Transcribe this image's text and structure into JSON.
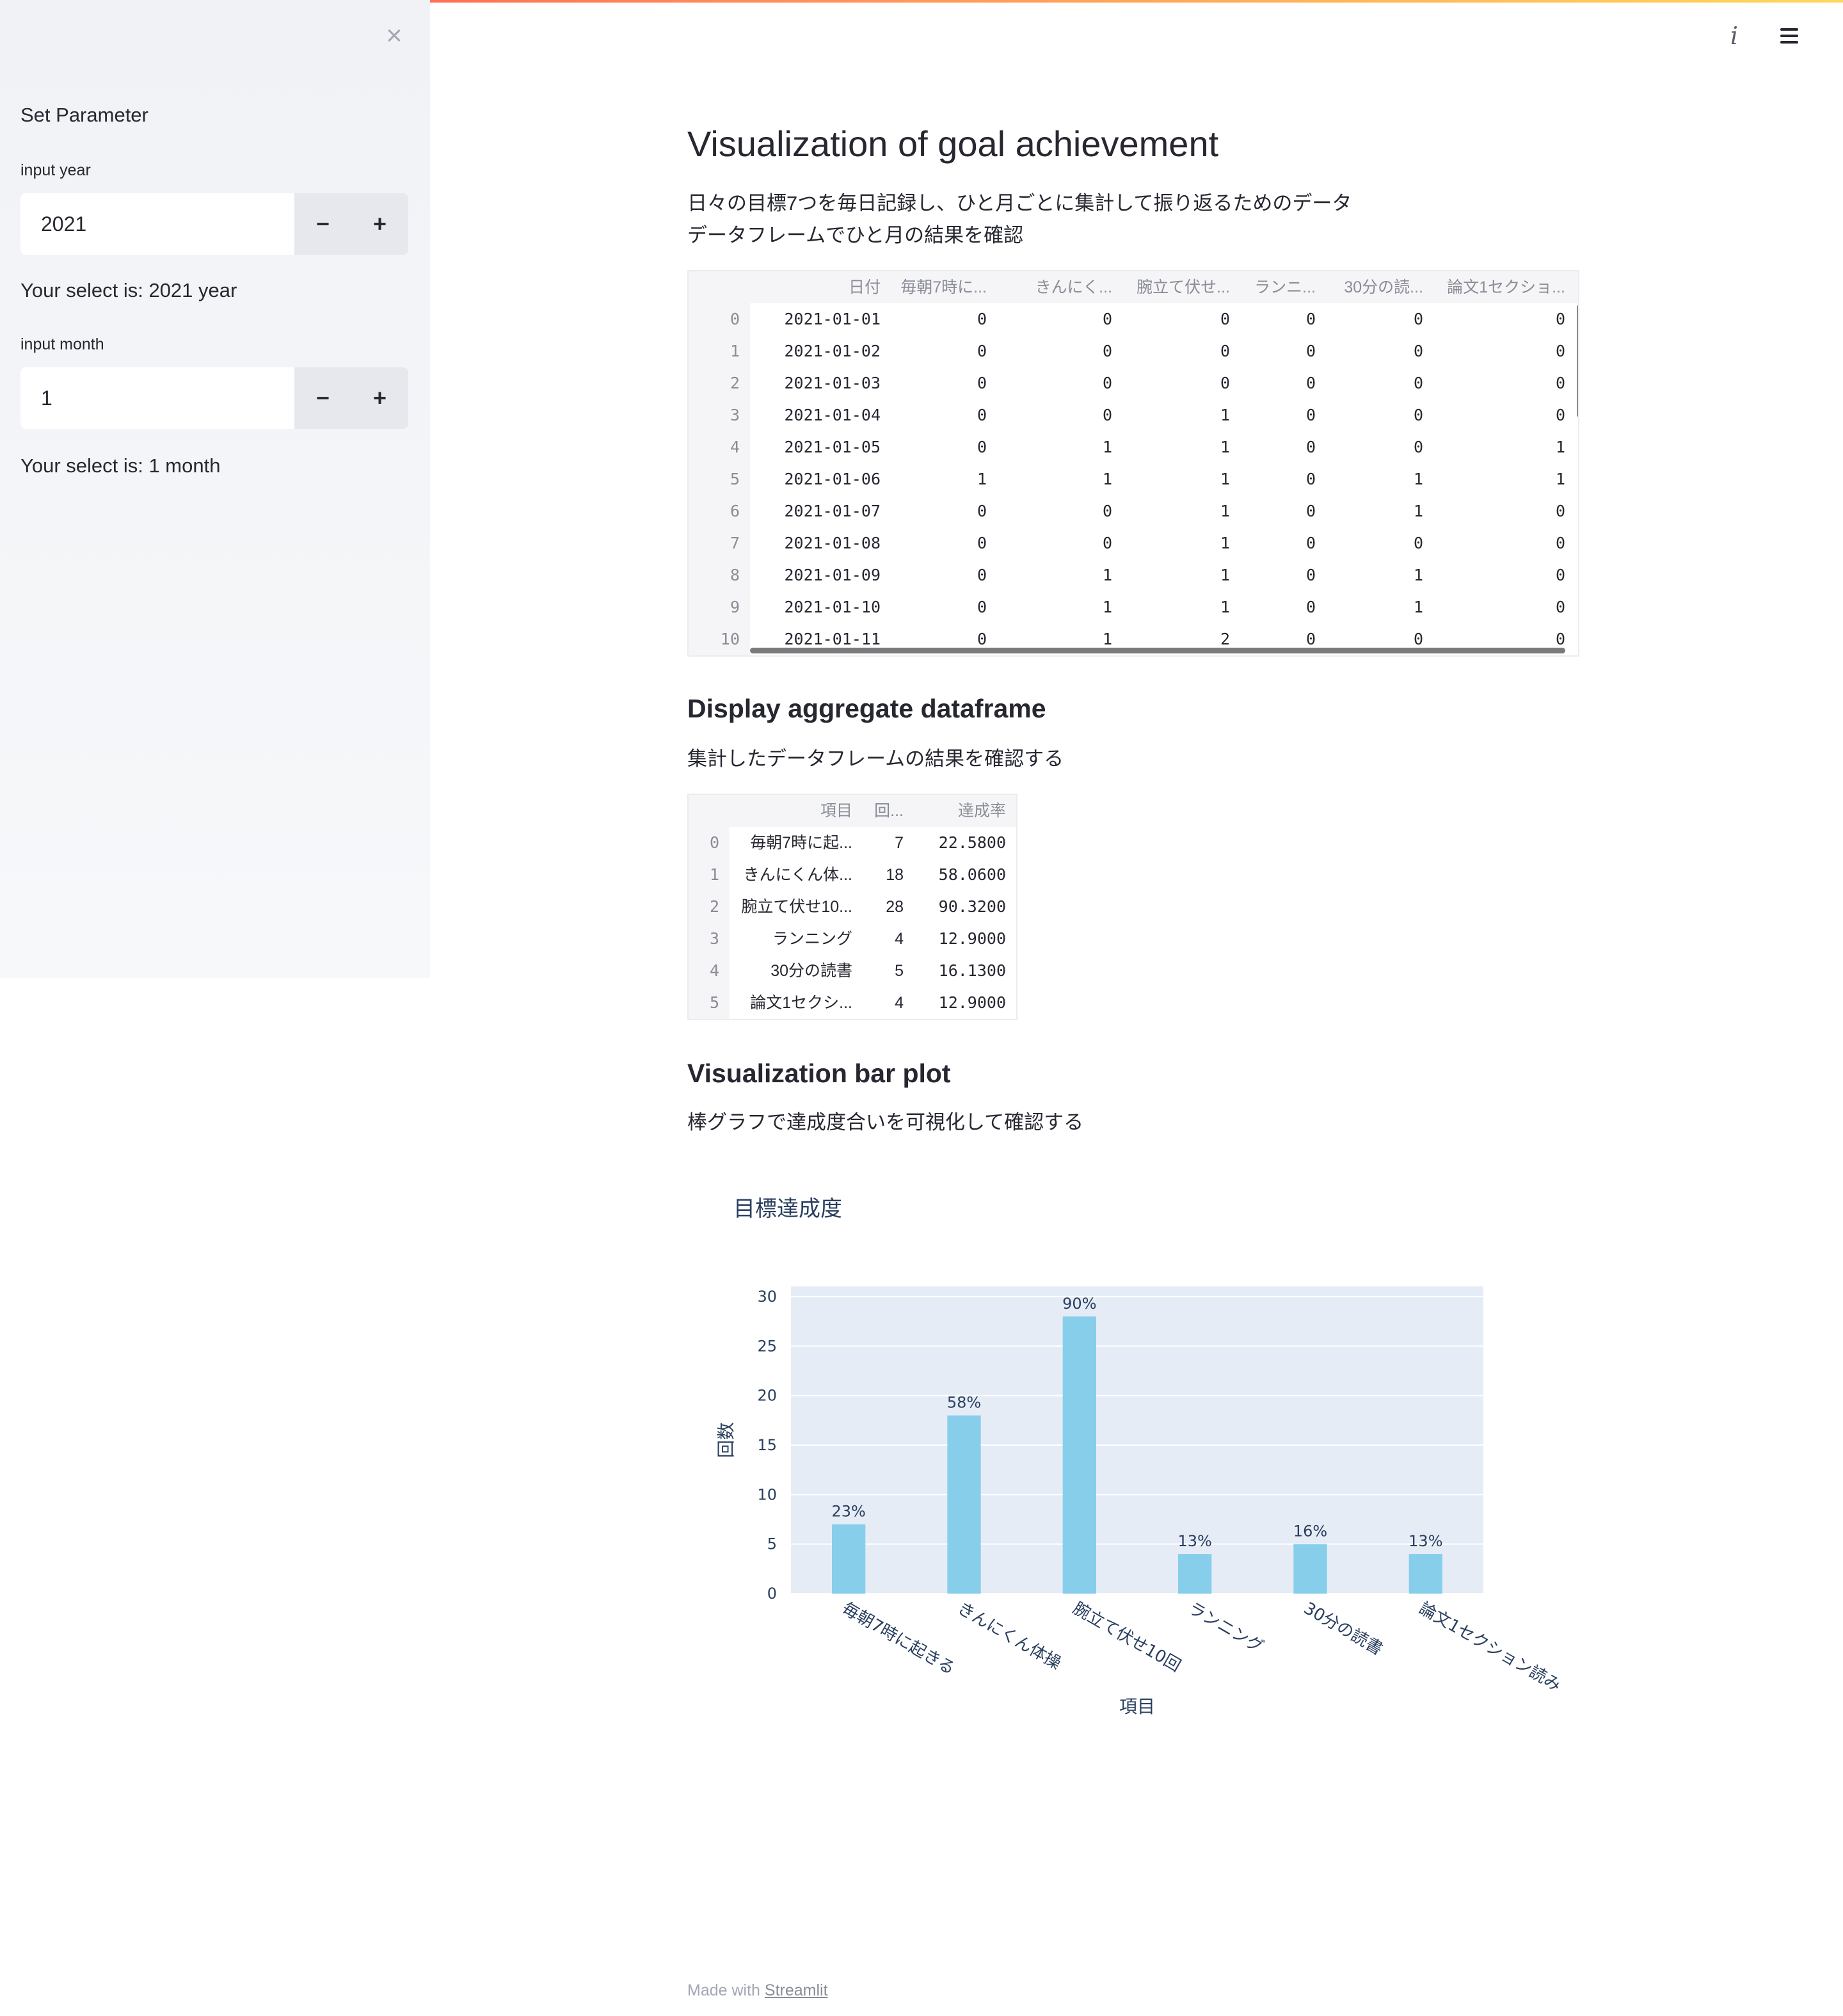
{
  "sidebar": {
    "close_icon": "close-icon",
    "header": "Set Parameter",
    "year": {
      "label": "input year",
      "value": "2021",
      "minus": "−",
      "plus": "+",
      "status": "Your select is: 2021 year"
    },
    "month": {
      "label": "input month",
      "value": "1",
      "minus": "−",
      "plus": "+",
      "status": "Your select is: 1 month"
    }
  },
  "header": {
    "info_glyph": "i",
    "info_icon": "info-icon",
    "menu_icon": "hamburger-menu-icon"
  },
  "main": {
    "title": "Visualization of goal achievement",
    "desc1": "日々の目標7つを毎日記録し、ひと月ごとに集計して振り返るためのデータ",
    "desc2": "データフレームでひと月の結果を確認",
    "df1": {
      "columns": [
        "日付",
        "毎朝7時に...",
        "きんにく...",
        "腕立て伏せ...",
        "ランニ...",
        "30分の読...",
        "論文1セクショ..."
      ],
      "rows": [
        {
          "idx": "0",
          "date": "2021-01-01",
          "v": [
            "0",
            "0",
            "0",
            "0",
            "0",
            "0"
          ]
        },
        {
          "idx": "1",
          "date": "2021-01-02",
          "v": [
            "0",
            "0",
            "0",
            "0",
            "0",
            "0"
          ]
        },
        {
          "idx": "2",
          "date": "2021-01-03",
          "v": [
            "0",
            "0",
            "0",
            "0",
            "0",
            "0"
          ]
        },
        {
          "idx": "3",
          "date": "2021-01-04",
          "v": [
            "0",
            "0",
            "1",
            "0",
            "0",
            "0"
          ]
        },
        {
          "idx": "4",
          "date": "2021-01-05",
          "v": [
            "0",
            "1",
            "1",
            "0",
            "0",
            "1"
          ]
        },
        {
          "idx": "5",
          "date": "2021-01-06",
          "v": [
            "1",
            "1",
            "1",
            "0",
            "1",
            "1"
          ]
        },
        {
          "idx": "6",
          "date": "2021-01-07",
          "v": [
            "0",
            "0",
            "1",
            "0",
            "1",
            "0"
          ]
        },
        {
          "idx": "7",
          "date": "2021-01-08",
          "v": [
            "0",
            "0",
            "1",
            "0",
            "0",
            "0"
          ]
        },
        {
          "idx": "8",
          "date": "2021-01-09",
          "v": [
            "0",
            "1",
            "1",
            "0",
            "1",
            "0"
          ]
        },
        {
          "idx": "9",
          "date": "2021-01-10",
          "v": [
            "0",
            "1",
            "1",
            "0",
            "1",
            "0"
          ]
        },
        {
          "idx": "10",
          "date": "2021-01-11",
          "v": [
            "0",
            "1",
            "2",
            "0",
            "0",
            "0"
          ]
        }
      ]
    },
    "agg_title": "Display aggregate dataframe",
    "agg_desc": "集計したデータフレームの結果を確認する",
    "df2": {
      "columns": [
        "項目",
        "回...",
        "達成率"
      ],
      "rows": [
        {
          "idx": "0",
          "item": "毎朝7時に起...",
          "count": "7",
          "rate": "22.5800"
        },
        {
          "idx": "1",
          "item": "きんにくん体...",
          "count": "18",
          "rate": "58.0600"
        },
        {
          "idx": "2",
          "item": "腕立て伏せ10...",
          "count": "28",
          "rate": "90.3200"
        },
        {
          "idx": "3",
          "item": "ランニング",
          "count": "4",
          "rate": "12.9000"
        },
        {
          "idx": "4",
          "item": "30分の読書",
          "count": "5",
          "rate": "16.1300"
        },
        {
          "idx": "5",
          "item": "論文1セクシ...",
          "count": "4",
          "rate": "12.9000"
        }
      ]
    },
    "bar_title": "Visualization bar plot",
    "bar_desc": "棒グラフで達成度合いを可視化して確認する",
    "footer": {
      "prefix": "Made with ",
      "link": "Streamlit"
    }
  },
  "chart_data": {
    "type": "bar",
    "title": "目標達成度",
    "xlabel": "項目",
    "ylabel": "回数",
    "categories": [
      "毎朝7時に起きる",
      "きんにくん体操",
      "腕立て伏せ10回",
      "ランニング",
      "30分の読書",
      "論文1セクション読み"
    ],
    "values": [
      7,
      18,
      28,
      4,
      5,
      4
    ],
    "data_labels": [
      "23%",
      "58%",
      "90%",
      "13%",
      "16%",
      "13%"
    ],
    "yticks": [
      "0",
      "5",
      "10",
      "15",
      "20",
      "25",
      "30"
    ],
    "ylim": [
      0,
      30
    ],
    "grid": true,
    "colors": {
      "bar": "#87ceeb",
      "plot_bg": "#e5ecf6",
      "grid": "#ffffff",
      "text": "#2a3f5f"
    }
  }
}
